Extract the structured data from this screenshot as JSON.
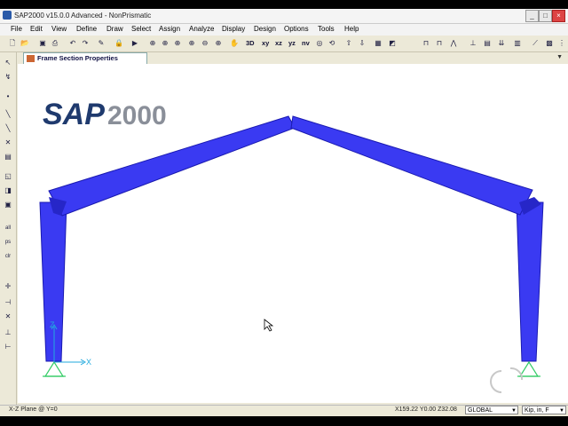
{
  "window": {
    "title": "SAP2000 v15.0.0 Advanced  - NonPrismatic"
  },
  "menu": [
    "File",
    "Edit",
    "View",
    "Define",
    "Draw",
    "Select",
    "Assign",
    "Analyze",
    "Display",
    "Design",
    "Options",
    "Tools",
    "Help"
  ],
  "toolbar": {
    "view_xy": "xy",
    "view_xz": "xz",
    "view_yz": "yz",
    "view_nv": "nv",
    "view_3d": "3D"
  },
  "tab": {
    "label": "Frame Section Properties"
  },
  "logo": {
    "text": "SAP2000"
  },
  "axes": {
    "z_label": "Z",
    "x_label": "X"
  },
  "status": {
    "plane": "X-Z Plane @ Y=0",
    "coords": "X159.22  Y0.00  Z32.08",
    "coord_system": "GLOBAL",
    "units": "Kip, in, F"
  },
  "colors": {
    "member_fill": "#3a3af2",
    "member_edge": "#1a1ab0",
    "support": "#33cc66",
    "axis": "#2ad",
    "logo_navy": "#1f3a6e",
    "logo_gray": "#8a8f99"
  }
}
